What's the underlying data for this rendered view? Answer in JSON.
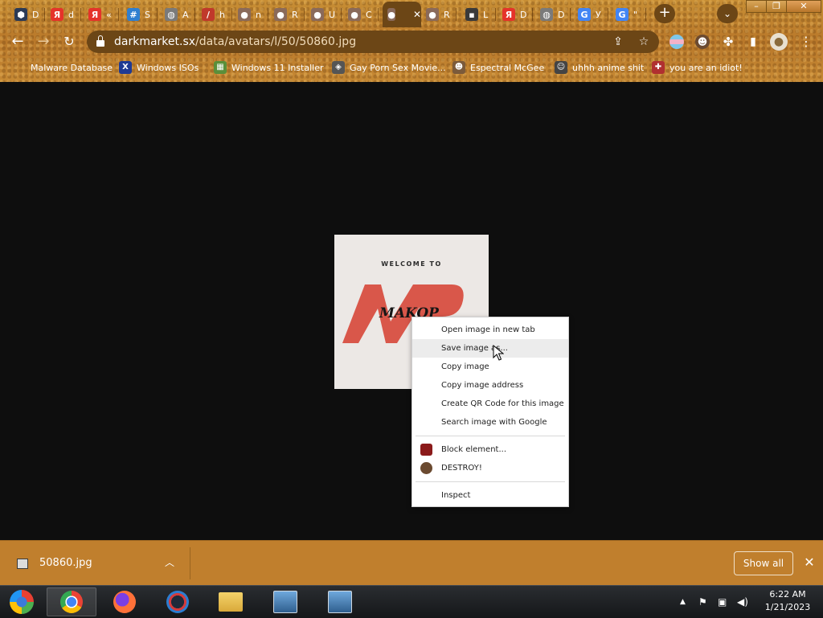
{
  "tabs": [
    {
      "glyph": "⬢",
      "title": "D",
      "color": "#2b3a55",
      "icon": "hexagon-icon"
    },
    {
      "glyph": "Я",
      "title": "d",
      "color": "#e5332a",
      "icon": "yandex-icon"
    },
    {
      "glyph": "Я",
      "title": "«",
      "color": "#e5332a",
      "icon": "yandex-icon"
    },
    {
      "glyph": "#",
      "title": "S",
      "color": "#2f7fd0",
      "icon": "grid-icon"
    },
    {
      "glyph": "◍",
      "title": "A",
      "color": "#7a7a7a",
      "icon": "globe-icon"
    },
    {
      "glyph": "/",
      "title": "h",
      "color": "#c0392b",
      "icon": "slash-icon"
    },
    {
      "glyph": "●",
      "title": "n",
      "color": "#8a6a5a",
      "icon": "avatar-icon"
    },
    {
      "glyph": "●",
      "title": "R",
      "color": "#8a6a5a",
      "icon": "avatar-icon"
    },
    {
      "glyph": "●",
      "title": "U",
      "color": "#8a6a5a",
      "icon": "avatar-icon"
    },
    {
      "glyph": "●",
      "title": "C",
      "color": "#8a6a5a",
      "icon": "avatar-icon"
    },
    {
      "glyph": "●",
      "title": "",
      "color": "#8a6a5a",
      "icon": "avatar-icon",
      "active": true
    },
    {
      "glyph": "●",
      "title": "R",
      "color": "#8a6a5a",
      "icon": "avatar-icon"
    },
    {
      "glyph": "▪",
      "title": "L",
      "color": "#3a3a3a",
      "icon": "terminal-icon"
    },
    {
      "glyph": "Я",
      "title": "D",
      "color": "#e5332a",
      "icon": "yandex-icon"
    },
    {
      "glyph": "◍",
      "title": "D",
      "color": "#7a7a7a",
      "icon": "globe-icon"
    },
    {
      "glyph": "G",
      "title": "У",
      "color": "#4285f4",
      "icon": "google-icon"
    },
    {
      "glyph": "G",
      "title": "\"",
      "color": "#4285f4",
      "icon": "google-icon"
    }
  ],
  "toolbar": {
    "url_host": "darkmarket.sx",
    "url_path": "/data/avatars/l/50/50860.jpg",
    "new_tab": "+",
    "tab_search": "⌄"
  },
  "bookmarks": [
    {
      "label": "Malware Database",
      "glyph": "",
      "color": "transparent"
    },
    {
      "label": "Windows ISOs",
      "glyph": "X",
      "color": "#1f3a93"
    },
    {
      "label": "Windows 11 Installer",
      "glyph": "▦",
      "color": "#5a8f3a"
    },
    {
      "label": "Gay Porn Sex Movie...",
      "glyph": "◈",
      "color": "#555555"
    },
    {
      "label": "Espectral McGee",
      "glyph": "☻",
      "color": "#7b5a3a"
    },
    {
      "label": "uhhh anime shit",
      "glyph": "☺",
      "color": "#444444"
    },
    {
      "label": "you are an idiot!",
      "glyph": "✚",
      "color": "#b03030"
    }
  ],
  "image": {
    "welcome": "WELCOME TO",
    "brand": "MAKOP",
    "accent": "#d9574a"
  },
  "context_menu": {
    "items": [
      {
        "label": "Open image in new tab",
        "name": "menu-open-image-new-tab"
      },
      {
        "label": "Save image as...",
        "name": "menu-save-image-as",
        "hover": true
      },
      {
        "label": "Copy image",
        "name": "menu-copy-image"
      },
      {
        "label": "Copy image address",
        "name": "menu-copy-image-address"
      },
      {
        "label": "Create QR Code for this image",
        "name": "menu-create-qr-code"
      },
      {
        "label": "Search image with Google",
        "name": "menu-search-image-google"
      },
      {
        "sep": true
      },
      {
        "label": "Block element...",
        "name": "menu-block-element",
        "icon": "ublock-icon",
        "icon_color": "#8b1a1a"
      },
      {
        "label": "DESTROY!",
        "name": "menu-destroy",
        "icon": "avatar-icon",
        "icon_color": "#6b4a30"
      },
      {
        "sep": true
      },
      {
        "label": "Inspect",
        "name": "menu-inspect"
      }
    ]
  },
  "download_shelf": {
    "file_name": "50860.jpg",
    "show_all": "Show all"
  },
  "taskbar": {
    "time": "6:22 AM",
    "date": "1/21/2023"
  }
}
